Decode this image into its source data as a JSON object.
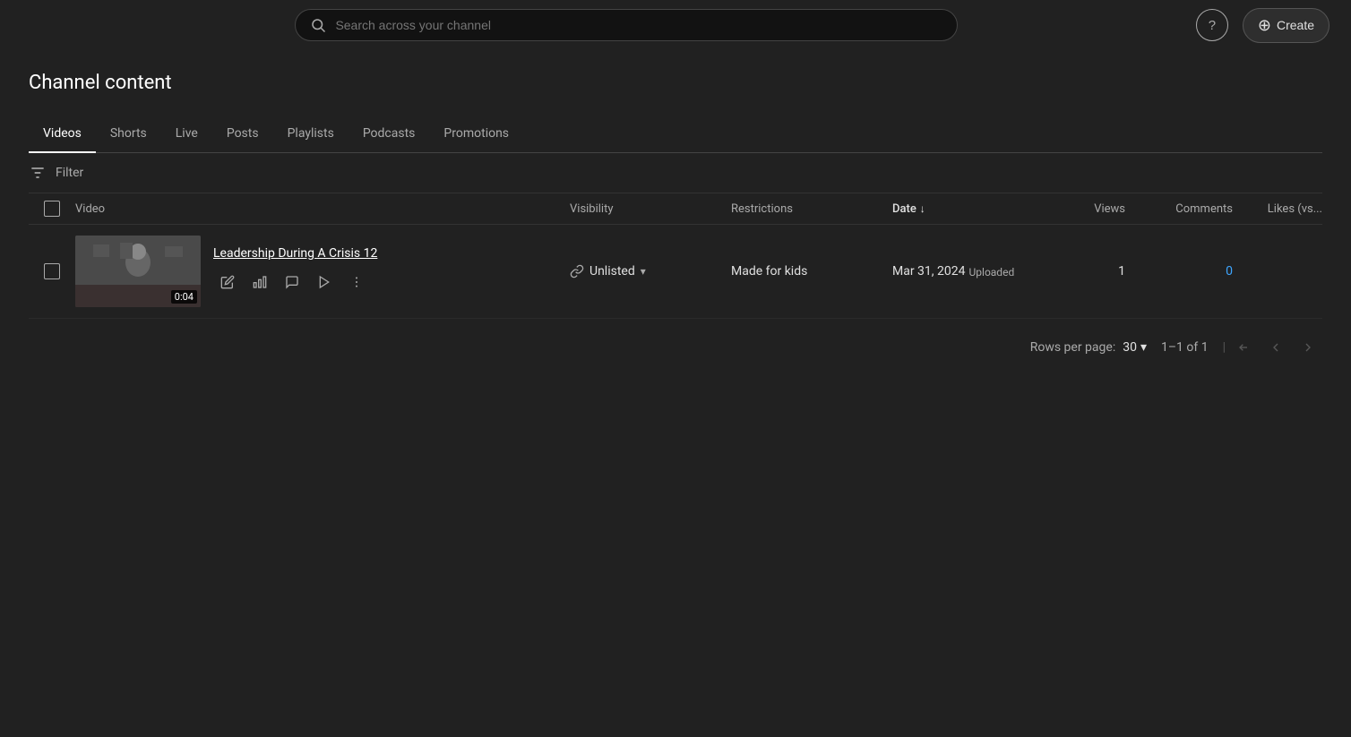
{
  "topbar": {
    "search_placeholder": "Search across your channel",
    "help_icon": "?",
    "create_label": "Create",
    "create_icon": "+"
  },
  "page": {
    "title": "Channel content"
  },
  "tabs": [
    {
      "id": "videos",
      "label": "Videos",
      "active": true
    },
    {
      "id": "shorts",
      "label": "Shorts",
      "active": false
    },
    {
      "id": "live",
      "label": "Live",
      "active": false
    },
    {
      "id": "posts",
      "label": "Posts",
      "active": false
    },
    {
      "id": "playlists",
      "label": "Playlists",
      "active": false
    },
    {
      "id": "podcasts",
      "label": "Podcasts",
      "active": false
    },
    {
      "id": "promotions",
      "label": "Promotions",
      "active": false
    }
  ],
  "filter": {
    "label": "Filter"
  },
  "table": {
    "headers": {
      "video": "Video",
      "visibility": "Visibility",
      "restrictions": "Restrictions",
      "date": "Date",
      "views": "Views",
      "comments": "Comments",
      "likes": "Likes (vs..."
    },
    "rows": [
      {
        "id": "row1",
        "title": "Leadership During A Crisis 12",
        "duration": "0:04",
        "visibility": "Unlisted",
        "restrictions": "Made for kids",
        "date": "Mar 31, 2024",
        "date_sub": "Uploaded",
        "views": "1",
        "comments": "0",
        "likes": ""
      }
    ]
  },
  "pagination": {
    "rows_per_page_label": "Rows per page:",
    "rows_per_page_value": "30",
    "page_info": "1–1 of 1"
  }
}
